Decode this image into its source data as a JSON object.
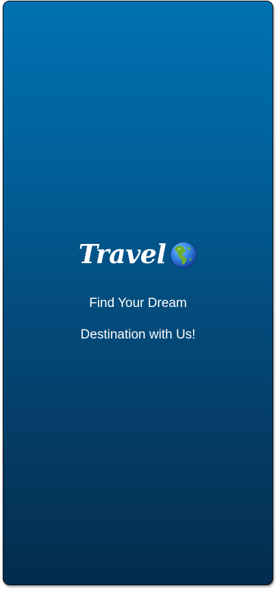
{
  "splash": {
    "brand_title": "Travel",
    "brand_icon": "globe-americas-icon",
    "tagline_line1": "Find Your Dream",
    "tagline_line2": "Destination with Us!"
  },
  "colors": {
    "gradient_top": "#0072b1",
    "gradient_bottom": "#032c4d",
    "text": "#ffffff"
  }
}
